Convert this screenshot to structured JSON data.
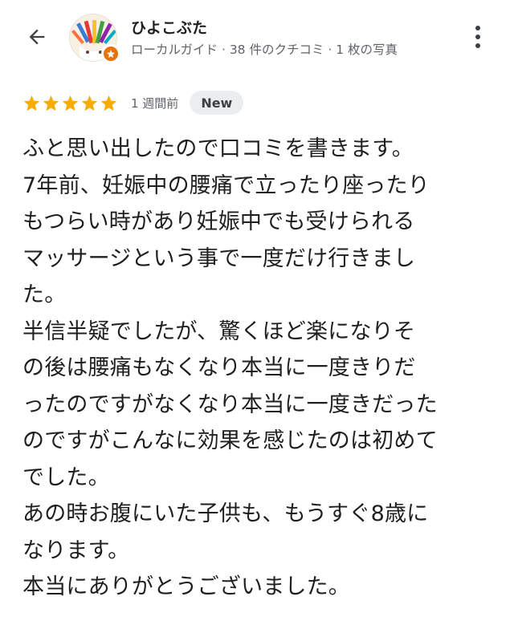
{
  "header": {
    "back_icon": "arrow-back-icon",
    "user_name": "ひよこぶた",
    "user_meta": "ローカルガイド · 38 件のクチコミ · 1 枚の写真",
    "avatar_icon": "colored-pencils-avatar",
    "badge_icon": "local-guide-star-icon",
    "more_icon": "more-vert-icon"
  },
  "review": {
    "rating": 5,
    "rating_max": 5,
    "date": "1 週間前",
    "new_badge": "New",
    "lines": [
      "ふと思い出したので口コミを書きます。",
      "7年前、妊娠中の腰痛で立ったり座ったり",
      "もつらい時があり妊娠中でも受けられる",
      "マッサージという事で一度だけ行きまし",
      "た。",
      "半信半疑でしたが、驚くほど楽になりそ",
      "の後は腰痛もなくなり本当に一度きりだ",
      "ったのですがなくなり本当に一度きだった",
      "のですがこんなに効果を感じたのは初めて",
      "でした。",
      "あの時お腹にいた子供も、もうすぐ8歳に",
      "なります。",
      "本当にありがとうございました。"
    ]
  },
  "colors": {
    "star": "#f9ab00",
    "badge_bg": "#ebedf0",
    "guide_badge": "#e8710a",
    "meta_text": "#5f6368",
    "body_text": "#1f1f1f"
  }
}
